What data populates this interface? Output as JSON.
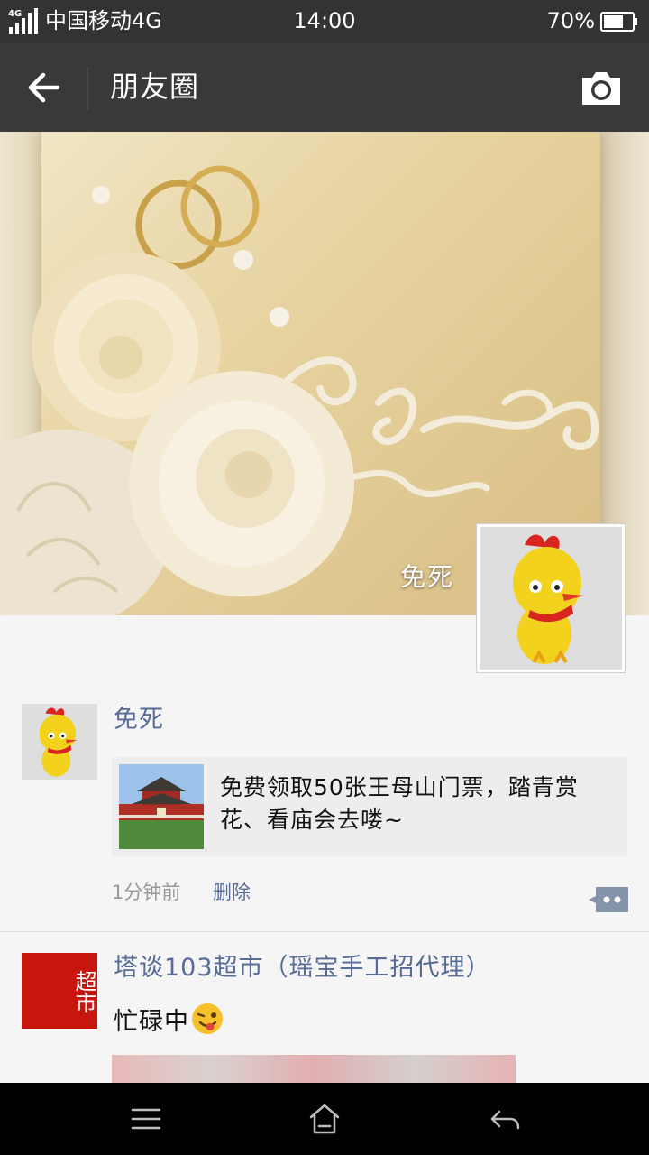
{
  "status_bar": {
    "network": "4G",
    "carrier": "中国移动4G",
    "time": "14:00",
    "battery": "70%"
  },
  "top_bar": {
    "title": "朋友圈",
    "back_icon": "arrow-left-icon",
    "camera_icon": "camera-icon"
  },
  "cover": {
    "username": "免死"
  },
  "feed": [
    {
      "author": "免死",
      "share_text": "免费领取50张王母山门票，踏青赏花、看庙会去喽~",
      "time": "1分钟前",
      "delete": "删除"
    },
    {
      "author": "塔谈103超市（瑶宝手工招代理）",
      "avatar_text": "超市",
      "text": "忙碌中",
      "emoji": "winking-tongue-emoji"
    }
  ],
  "colors": {
    "status_bar": "#333336",
    "top_bar": "#39393b",
    "link": "#576b95",
    "nav_bar": "#000000"
  }
}
